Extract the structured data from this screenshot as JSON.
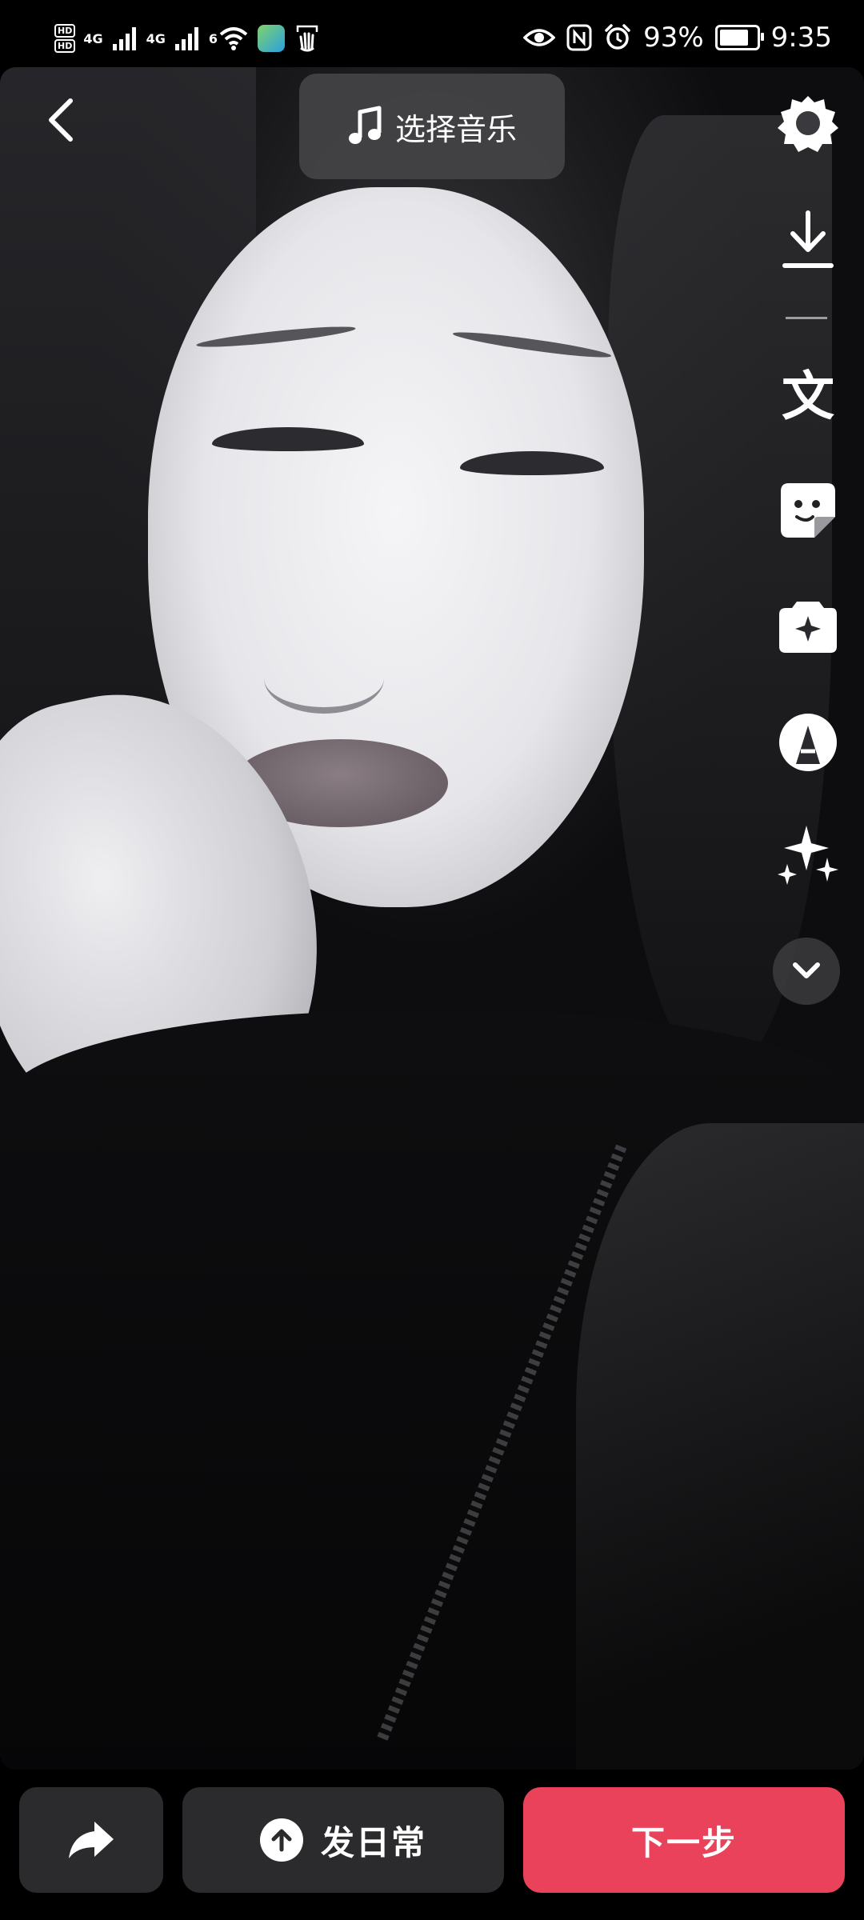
{
  "status_bar": {
    "hd_badges": [
      "HD",
      "HD"
    ],
    "net1": "4G",
    "net2": "4G",
    "wifi_gen": "6",
    "battery_percent": "93%",
    "battery_level": 0.93,
    "time": "9:35",
    "icons": [
      "hd-icon",
      "signal-icon",
      "signal-icon",
      "wifi-icon",
      "app-notification-icon",
      "hand-icon",
      "eye-icon",
      "nfc-icon",
      "alarm-icon",
      "battery-icon"
    ]
  },
  "top_bar": {
    "back_icon": "chevron-left-icon",
    "music_label": "选择音乐",
    "music_icon": "music-note-icon"
  },
  "toolbar": {
    "items": [
      {
        "name": "settings",
        "icon": "gear-icon"
      },
      {
        "name": "download",
        "icon": "download-icon"
      },
      {
        "name": "text",
        "icon": "text-icon",
        "glyph": "文"
      },
      {
        "name": "sticker",
        "icon": "sticker-icon"
      },
      {
        "name": "effects",
        "icon": "effects-icon"
      },
      {
        "name": "filter",
        "icon": "filter-icon"
      },
      {
        "name": "enhance",
        "icon": "sparkle-icon"
      },
      {
        "name": "more",
        "icon": "chevron-down-icon"
      }
    ]
  },
  "bottom_bar": {
    "share_icon": "share-arrow-icon",
    "post_daily_label": "发日常",
    "post_daily_icon": "upload-circle-icon",
    "next_label": "下一步"
  },
  "colors": {
    "accent_red": "#e9425a",
    "button_dark": "#2b2b2d",
    "overlay_pill": "#464648"
  }
}
